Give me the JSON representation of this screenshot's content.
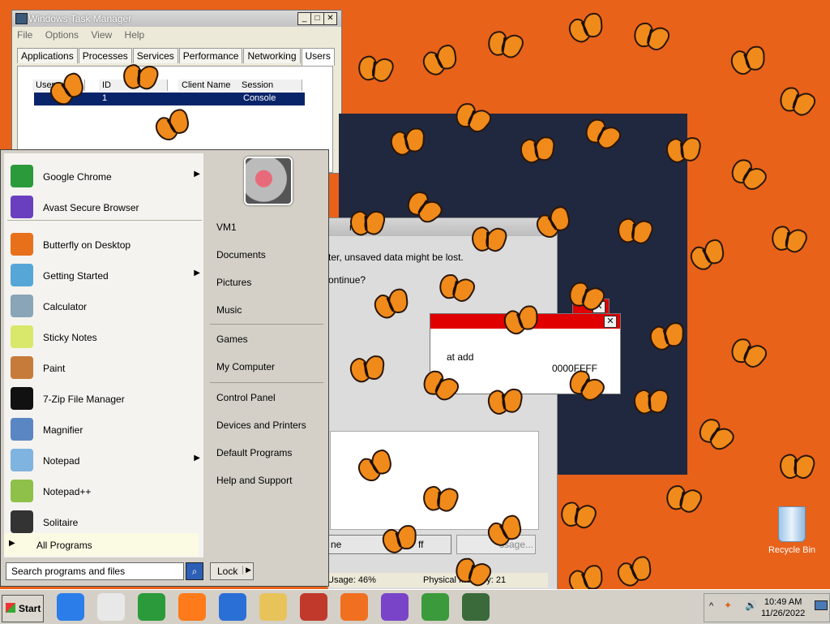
{
  "task_manager": {
    "title": "Windows Task Manager",
    "menu": [
      "File",
      "Options",
      "View",
      "Help"
    ],
    "tabs": [
      "Applications",
      "Processes",
      "Services",
      "Performance",
      "Networking",
      "Users"
    ],
    "selected_tab": "Users",
    "columns": [
      "User",
      "ID",
      "Client Name",
      "Session"
    ],
    "row": {
      "id": "1",
      "session": "Console"
    },
    "status_memory": "Physical Memory: 21",
    "status_usage": "Usage: 46%"
  },
  "dialog": {
    "title_fragment": "r",
    "line1": "ter, unsaved data might be lost.",
    "line2": "ontinue?",
    "error_text1": "at add",
    "error_text2": "0000FFFF",
    "btn_fragment": "ssage...",
    "btn_fragment2": "ff",
    "btn_fragment3": "ne"
  },
  "start_menu": {
    "left_items": [
      {
        "label": "Google Chrome",
        "arrow": true,
        "icon": "chrome-icon",
        "color": "#2a9a3a"
      },
      {
        "label": "Avast Secure Browser",
        "arrow": false,
        "icon": "avast-browser-icon",
        "color": "#6a3fbf"
      },
      {
        "label": "Butterfly on Desktop",
        "arrow": false,
        "icon": "butterfly-icon",
        "color": "#e8701a"
      },
      {
        "label": "Getting Started",
        "arrow": true,
        "icon": "getting-started-icon",
        "color": "#57a6d8"
      },
      {
        "label": "Calculator",
        "arrow": false,
        "icon": "calculator-icon",
        "color": "#8aa4b8"
      },
      {
        "label": "Sticky Notes",
        "arrow": false,
        "icon": "sticky-notes-icon",
        "color": "#d9e86a"
      },
      {
        "label": "Paint",
        "arrow": false,
        "icon": "paint-icon",
        "color": "#c77b3a"
      },
      {
        "label": "7-Zip File Manager",
        "arrow": false,
        "icon": "7zip-icon",
        "color": "#111111"
      },
      {
        "label": "Magnifier",
        "arrow": false,
        "icon": "magnifier-icon",
        "color": "#5b86c4"
      },
      {
        "label": "Notepad",
        "arrow": true,
        "icon": "notepad-icon",
        "color": "#7fb3e0"
      },
      {
        "label": "Notepad++",
        "arrow": false,
        "icon": "notepadpp-icon",
        "color": "#8ec04a"
      },
      {
        "label": "Solitaire",
        "arrow": false,
        "icon": "solitaire-icon",
        "color": "#333333"
      }
    ],
    "all_programs": "All Programs",
    "right_items": [
      "VM1",
      "Documents",
      "Pictures",
      "Music",
      "Games",
      "My Computer",
      "Control Panel",
      "Devices and Printers",
      "Default Programs",
      "Help and Support"
    ],
    "search_placeholder": "Search programs and files",
    "lock_label": "Lock"
  },
  "taskbar": {
    "start_label": "Start",
    "icons": [
      "internet-explorer-icon",
      "media-player-icon",
      "chrome-icon",
      "firefox-icon",
      "vs-code-icon",
      "file-explorer-icon",
      "red-app-icon",
      "avast-icon",
      "avast-browser-icon",
      "gecko-app-icon",
      "task-manager-icon"
    ],
    "time": "10:49 AM",
    "date": "11/26/2022"
  },
  "desktop": {
    "recycle_bin_label": "Recycle Bin"
  }
}
